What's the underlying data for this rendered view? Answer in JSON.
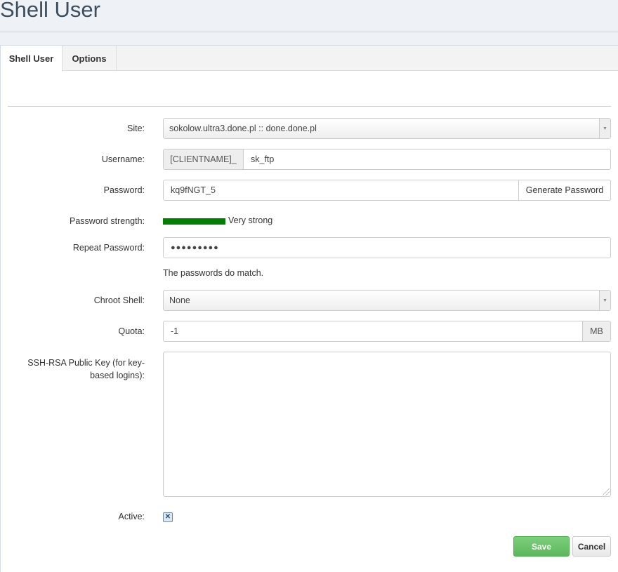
{
  "page": {
    "title": "Shell User"
  },
  "tabs": [
    {
      "label": "Shell User",
      "active": true
    },
    {
      "label": "Options",
      "active": false
    }
  ],
  "form": {
    "site": {
      "label": "Site:",
      "value": "sokolow.ultra3.done.pl :: done.done.pl"
    },
    "username": {
      "label": "Username:",
      "prefix": "[CLIENTNAME]_",
      "value": "sk_ftp"
    },
    "password": {
      "label": "Password:",
      "value": "kq9fNGT_5",
      "generate_label": "Generate Password"
    },
    "strength": {
      "label": "Password strength:",
      "text": "Very strong",
      "color": "#008000"
    },
    "repeat_password": {
      "label": "Repeat Password:",
      "value": "●●●●●●●●●",
      "message": "The passwords do match."
    },
    "chroot": {
      "label": "Chroot Shell:",
      "value": "None"
    },
    "quota": {
      "label": "Quota:",
      "value": "-1",
      "unit": "MB"
    },
    "ssh_key": {
      "label_line1": "SSH-RSA Public Key (for key-",
      "label_line2": "based logins):",
      "value": ""
    },
    "active": {
      "label": "Active:",
      "checked": true,
      "mark": "✕"
    }
  },
  "actions": {
    "save_label": "Save",
    "cancel_label": "Cancel"
  },
  "colors": {
    "save": "#5cb85c",
    "page_bg": "#eef2f7"
  }
}
